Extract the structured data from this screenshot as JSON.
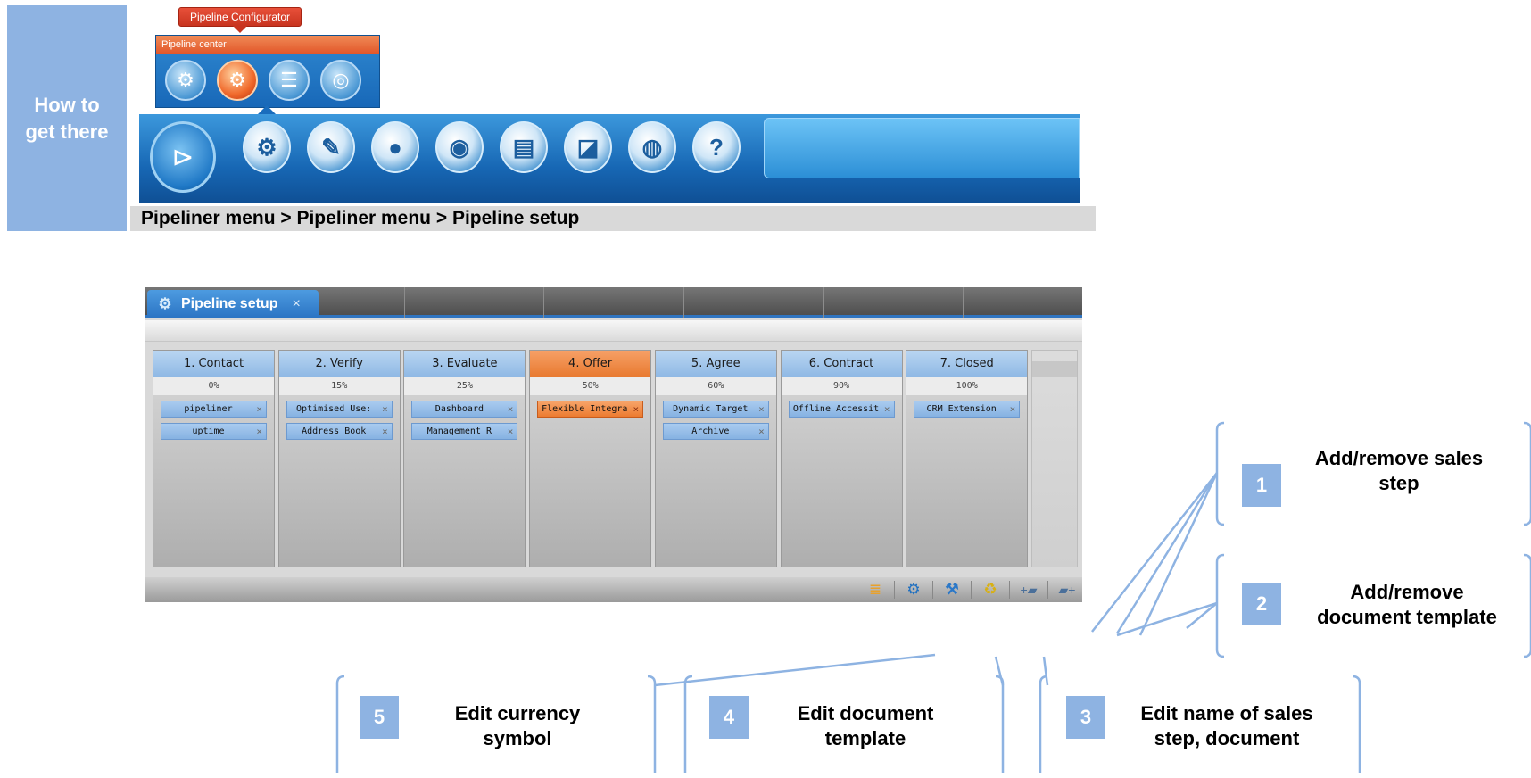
{
  "howto": {
    "line1": "How to",
    "line2": "get there"
  },
  "pipeline_configurator": {
    "tooltip": "Pipeline Configurator",
    "panel_title": "Pipeline center",
    "icons": [
      "gears-icon",
      "pipeline-gear-icon",
      "settings-eye-icon",
      "target-icon"
    ]
  },
  "main_menu": {
    "logo": "pipeliner-logo",
    "icons": [
      "gear-icon",
      "book-icon",
      "user-icon",
      "chart-ring-icon",
      "printer-icon",
      "report-chart-icon",
      "lifebuoy-icon",
      "help-icon"
    ],
    "help_glyph": "?"
  },
  "breadcrumb": "Pipeliner menu > Pipeliner menu > Pipeline setup",
  "window": {
    "tab_label": "Pipeline setup",
    "tab_close": "×",
    "columns": [
      {
        "title": "1. Contact",
        "pct": "0%",
        "cards": [
          "pipeliner",
          "uptime"
        ],
        "highlight": false
      },
      {
        "title": "2. Verify",
        "pct": "15%",
        "cards": [
          "Optimised Use:",
          "Address Book"
        ],
        "highlight": false
      },
      {
        "title": "3. Evaluate",
        "pct": "25%",
        "cards": [
          "Dashboard",
          "Management R"
        ],
        "highlight": false
      },
      {
        "title": "4. Offer",
        "pct": "50%",
        "cards": [
          "Flexible Integra"
        ],
        "highlight": true
      },
      {
        "title": "5. Agree",
        "pct": "60%",
        "cards": [
          "Dynamic Target",
          "Archive"
        ],
        "highlight": false
      },
      {
        "title": "6. Contract",
        "pct": "90%",
        "cards": [
          "Offline Accessit"
        ],
        "highlight": false
      },
      {
        "title": "7. Closed",
        "pct": "100%",
        "cards": [
          "CRM Extension"
        ],
        "highlight": false
      }
    ],
    "card_close": "×",
    "bottom_icons": [
      "currency-stack-icon",
      "gear-icon",
      "tools-icon",
      "recycle-bin-icon",
      "add-step-icon",
      "add-template-icon"
    ]
  },
  "callouts": [
    {
      "num": "1",
      "text_line1": "Add/remove sales",
      "text_line2": "step"
    },
    {
      "num": "2",
      "text_line1": "Add/remove",
      "text_line2": "document template"
    },
    {
      "num": "3",
      "text_line1": "Edit name of sales",
      "text_line2": "step, document"
    },
    {
      "num": "4",
      "text_line1": "Edit document",
      "text_line2": "template"
    },
    {
      "num": "5",
      "text_line1": "Edit currency",
      "text_line2": "symbol"
    }
  ],
  "colors": {
    "callout": "#8eb3e2",
    "accent_blue": "#2f74c0",
    "accent_orange": "#e8792f"
  }
}
